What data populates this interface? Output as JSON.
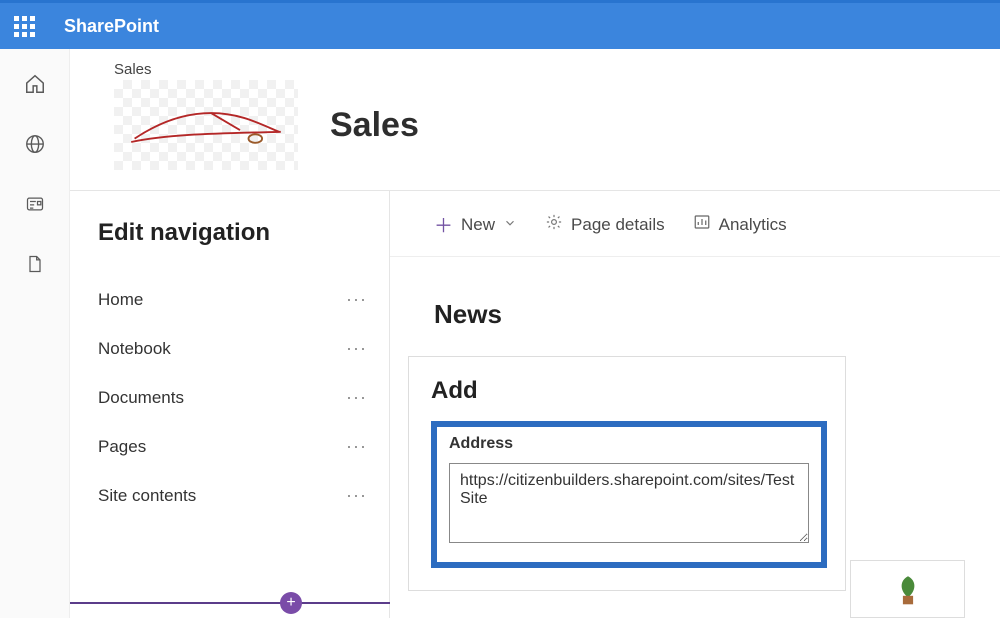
{
  "header": {
    "app_name": "SharePoint"
  },
  "site": {
    "label": "Sales",
    "title": "Sales"
  },
  "nav": {
    "title": "Edit navigation",
    "items": [
      {
        "label": "Home"
      },
      {
        "label": "Notebook"
      },
      {
        "label": "Documents"
      },
      {
        "label": "Pages"
      },
      {
        "label": "Site contents"
      }
    ]
  },
  "commands": {
    "new_label": "New",
    "page_details_label": "Page details",
    "analytics_label": "Analytics"
  },
  "news": {
    "heading": "News"
  },
  "add_panel": {
    "title": "Add",
    "address_label": "Address",
    "address_value": "https://citizenbuilders.sharepoint.com/sites/TestSite"
  }
}
